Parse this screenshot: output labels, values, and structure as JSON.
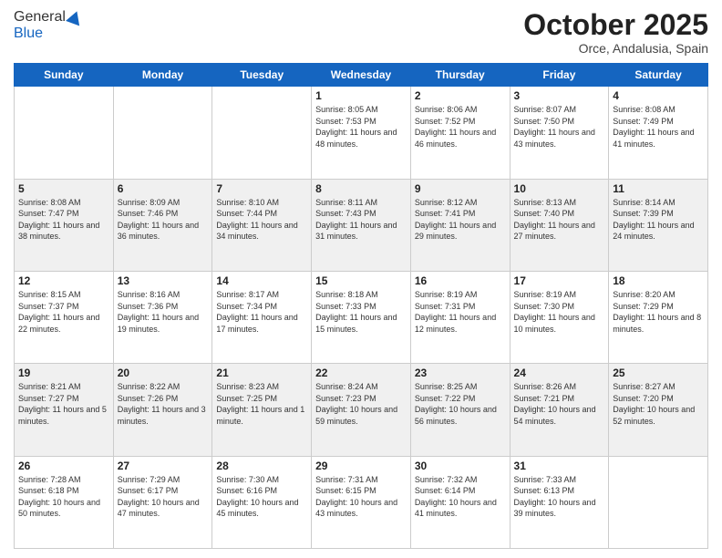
{
  "logo": {
    "line1": "General",
    "line2": "Blue"
  },
  "header": {
    "month": "October 2025",
    "location": "Orce, Andalusia, Spain"
  },
  "days_of_week": [
    "Sunday",
    "Monday",
    "Tuesday",
    "Wednesday",
    "Thursday",
    "Friday",
    "Saturday"
  ],
  "weeks": [
    [
      {
        "day": "",
        "info": ""
      },
      {
        "day": "",
        "info": ""
      },
      {
        "day": "",
        "info": ""
      },
      {
        "day": "1",
        "info": "Sunrise: 8:05 AM\nSunset: 7:53 PM\nDaylight: 11 hours\nand 48 minutes."
      },
      {
        "day": "2",
        "info": "Sunrise: 8:06 AM\nSunset: 7:52 PM\nDaylight: 11 hours\nand 46 minutes."
      },
      {
        "day": "3",
        "info": "Sunrise: 8:07 AM\nSunset: 7:50 PM\nDaylight: 11 hours\nand 43 minutes."
      },
      {
        "day": "4",
        "info": "Sunrise: 8:08 AM\nSunset: 7:49 PM\nDaylight: 11 hours\nand 41 minutes."
      }
    ],
    [
      {
        "day": "5",
        "info": "Sunrise: 8:08 AM\nSunset: 7:47 PM\nDaylight: 11 hours\nand 38 minutes."
      },
      {
        "day": "6",
        "info": "Sunrise: 8:09 AM\nSunset: 7:46 PM\nDaylight: 11 hours\nand 36 minutes."
      },
      {
        "day": "7",
        "info": "Sunrise: 8:10 AM\nSunset: 7:44 PM\nDaylight: 11 hours\nand 34 minutes."
      },
      {
        "day": "8",
        "info": "Sunrise: 8:11 AM\nSunset: 7:43 PM\nDaylight: 11 hours\nand 31 minutes."
      },
      {
        "day": "9",
        "info": "Sunrise: 8:12 AM\nSunset: 7:41 PM\nDaylight: 11 hours\nand 29 minutes."
      },
      {
        "day": "10",
        "info": "Sunrise: 8:13 AM\nSunset: 7:40 PM\nDaylight: 11 hours\nand 27 minutes."
      },
      {
        "day": "11",
        "info": "Sunrise: 8:14 AM\nSunset: 7:39 PM\nDaylight: 11 hours\nand 24 minutes."
      }
    ],
    [
      {
        "day": "12",
        "info": "Sunrise: 8:15 AM\nSunset: 7:37 PM\nDaylight: 11 hours\nand 22 minutes."
      },
      {
        "day": "13",
        "info": "Sunrise: 8:16 AM\nSunset: 7:36 PM\nDaylight: 11 hours\nand 19 minutes."
      },
      {
        "day": "14",
        "info": "Sunrise: 8:17 AM\nSunset: 7:34 PM\nDaylight: 11 hours\nand 17 minutes."
      },
      {
        "day": "15",
        "info": "Sunrise: 8:18 AM\nSunset: 7:33 PM\nDaylight: 11 hours\nand 15 minutes."
      },
      {
        "day": "16",
        "info": "Sunrise: 8:19 AM\nSunset: 7:31 PM\nDaylight: 11 hours\nand 12 minutes."
      },
      {
        "day": "17",
        "info": "Sunrise: 8:19 AM\nSunset: 7:30 PM\nDaylight: 11 hours\nand 10 minutes."
      },
      {
        "day": "18",
        "info": "Sunrise: 8:20 AM\nSunset: 7:29 PM\nDaylight: 11 hours\nand 8 minutes."
      }
    ],
    [
      {
        "day": "19",
        "info": "Sunrise: 8:21 AM\nSunset: 7:27 PM\nDaylight: 11 hours\nand 5 minutes."
      },
      {
        "day": "20",
        "info": "Sunrise: 8:22 AM\nSunset: 7:26 PM\nDaylight: 11 hours\nand 3 minutes."
      },
      {
        "day": "21",
        "info": "Sunrise: 8:23 AM\nSunset: 7:25 PM\nDaylight: 11 hours\nand 1 minute."
      },
      {
        "day": "22",
        "info": "Sunrise: 8:24 AM\nSunset: 7:23 PM\nDaylight: 10 hours\nand 59 minutes."
      },
      {
        "day": "23",
        "info": "Sunrise: 8:25 AM\nSunset: 7:22 PM\nDaylight: 10 hours\nand 56 minutes."
      },
      {
        "day": "24",
        "info": "Sunrise: 8:26 AM\nSunset: 7:21 PM\nDaylight: 10 hours\nand 54 minutes."
      },
      {
        "day": "25",
        "info": "Sunrise: 8:27 AM\nSunset: 7:20 PM\nDaylight: 10 hours\nand 52 minutes."
      }
    ],
    [
      {
        "day": "26",
        "info": "Sunrise: 7:28 AM\nSunset: 6:18 PM\nDaylight: 10 hours\nand 50 minutes."
      },
      {
        "day": "27",
        "info": "Sunrise: 7:29 AM\nSunset: 6:17 PM\nDaylight: 10 hours\nand 47 minutes."
      },
      {
        "day": "28",
        "info": "Sunrise: 7:30 AM\nSunset: 6:16 PM\nDaylight: 10 hours\nand 45 minutes."
      },
      {
        "day": "29",
        "info": "Sunrise: 7:31 AM\nSunset: 6:15 PM\nDaylight: 10 hours\nand 43 minutes."
      },
      {
        "day": "30",
        "info": "Sunrise: 7:32 AM\nSunset: 6:14 PM\nDaylight: 10 hours\nand 41 minutes."
      },
      {
        "day": "31",
        "info": "Sunrise: 7:33 AM\nSunset: 6:13 PM\nDaylight: 10 hours\nand 39 minutes."
      },
      {
        "day": "",
        "info": ""
      }
    ]
  ]
}
